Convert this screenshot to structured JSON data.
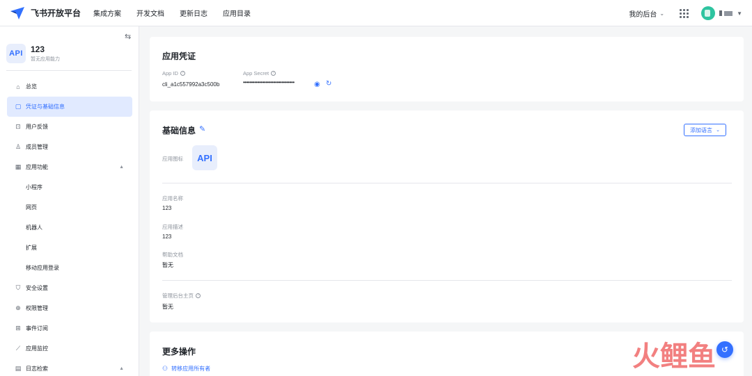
{
  "topbar": {
    "brand": "飞书开放平台",
    "nav": [
      "集成方案",
      "开发文档",
      "更新日志",
      "应用目录"
    ],
    "console": "我的后台"
  },
  "sidebar": {
    "app_logo_text": "API",
    "app_name": "123",
    "app_sub": "暂无应用能力",
    "items": [
      {
        "label": "总览",
        "icon": "home-icon"
      },
      {
        "label": "凭证与基础信息",
        "icon": "credential-icon",
        "active": true
      },
      {
        "label": "用户反馈",
        "icon": "feedback-icon"
      },
      {
        "label": "成员管理",
        "icon": "member-icon"
      },
      {
        "label": "应用功能",
        "icon": "feature-icon",
        "expanded": true
      },
      {
        "label": "小程序",
        "sub": true
      },
      {
        "label": "网页",
        "sub": true
      },
      {
        "label": "机器人",
        "sub": true
      },
      {
        "label": "扩展",
        "sub": true
      },
      {
        "label": "移动应用登录",
        "sub": true
      },
      {
        "label": "安全设置",
        "icon": "shield-icon"
      },
      {
        "label": "权限管理",
        "icon": "lock-icon"
      },
      {
        "label": "事件订阅",
        "icon": "event-icon"
      },
      {
        "label": "应用监控",
        "icon": "monitor-icon"
      },
      {
        "label": "日志检索",
        "icon": "log-icon",
        "expanded": true
      }
    ]
  },
  "credentials": {
    "title": "应用凭证",
    "app_id_label": "App ID",
    "app_id": "cli_a1c557992a3c500b",
    "secret_label": "App Secret",
    "secret_masked": "••••••••••••••••••••••••••••••••"
  },
  "basic": {
    "title": "基础信息",
    "add_lang": "添加语言",
    "icon_label": "应用图标",
    "icon_text": "API",
    "name_label": "应用名称",
    "name": "123",
    "desc_label": "应用描述",
    "desc": "123",
    "help_label": "帮助文档",
    "help": "暂无",
    "admin_label": "管理后台主页",
    "admin": "暂无"
  },
  "more": {
    "title": "更多操作",
    "transfer": "转移应用所有者"
  },
  "watermark": [
    "火",
    "鲤",
    "鱼"
  ],
  "colors": {
    "accent": "#3370ff",
    "active_bg": "#e1eaff",
    "watermark": "#f06b6b"
  }
}
